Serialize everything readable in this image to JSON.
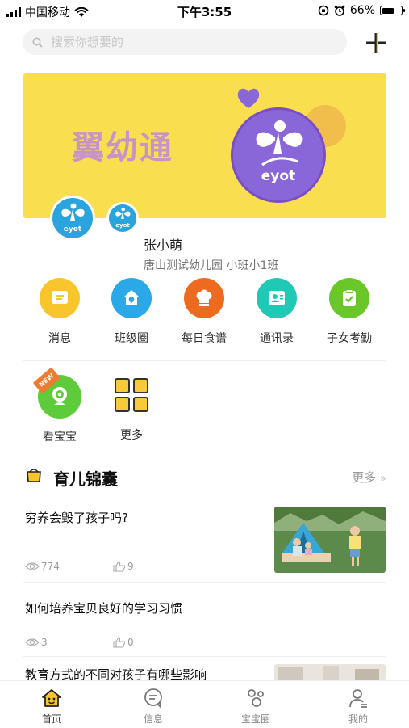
{
  "status_bar": {
    "carrier": "中国移动",
    "time": "下午3:55",
    "battery": "66%",
    "battery_level": 0.66
  },
  "search": {
    "placeholder": "搜索你想要的"
  },
  "banner": {
    "title": "翼幼通",
    "logo_text": "eyot"
  },
  "profile": {
    "name": "张小萌",
    "school": "唐山测试幼儿园 小班小1班",
    "avatar_text": "eyot"
  },
  "menu": [
    {
      "label": "消息",
      "color": "#f8c62c",
      "icon": "message-icon"
    },
    {
      "label": "班级圈",
      "color": "#2aa8e8",
      "icon": "house-heart-icon"
    },
    {
      "label": "每日食谱",
      "color": "#ee6a1e",
      "icon": "chef-hat-icon"
    },
    {
      "label": "通讯录",
      "color": "#1ec9b6",
      "icon": "contact-card-icon"
    },
    {
      "label": "子女考勤",
      "color": "#6ac72a",
      "icon": "clipboard-check-icon"
    }
  ],
  "menu2": [
    {
      "label": "看宝宝",
      "color": "#5ecb3a",
      "icon": "webcam-icon",
      "badge": "NEW"
    },
    {
      "label": "更多",
      "icon": "grid-icon"
    }
  ],
  "section": {
    "title": "育儿锦囊",
    "more": "更多",
    "more_icon": "double-chevron-right-icon"
  },
  "articles": [
    {
      "title": "穷养会毁了孩子吗?",
      "views": "774",
      "likes": "9",
      "has_image": true
    },
    {
      "title": "如何培养宝贝良好的学习习惯",
      "views": "3",
      "likes": "0",
      "has_image": false
    },
    {
      "title": "教育方式的不同对孩子有哪些影响",
      "has_image": true
    }
  ],
  "tabs": [
    {
      "label": "首页",
      "icon": "home-icon",
      "active": true
    },
    {
      "label": "信息",
      "icon": "chat-bubble-icon",
      "active": false
    },
    {
      "label": "宝宝圈",
      "icon": "circles-icon",
      "active": false
    },
    {
      "label": "我的",
      "icon": "person-icon",
      "active": false
    }
  ],
  "colors": {
    "accent": "#f8c62c",
    "banner": "#f9df4f",
    "text": "#222222",
    "muted": "#999999"
  }
}
